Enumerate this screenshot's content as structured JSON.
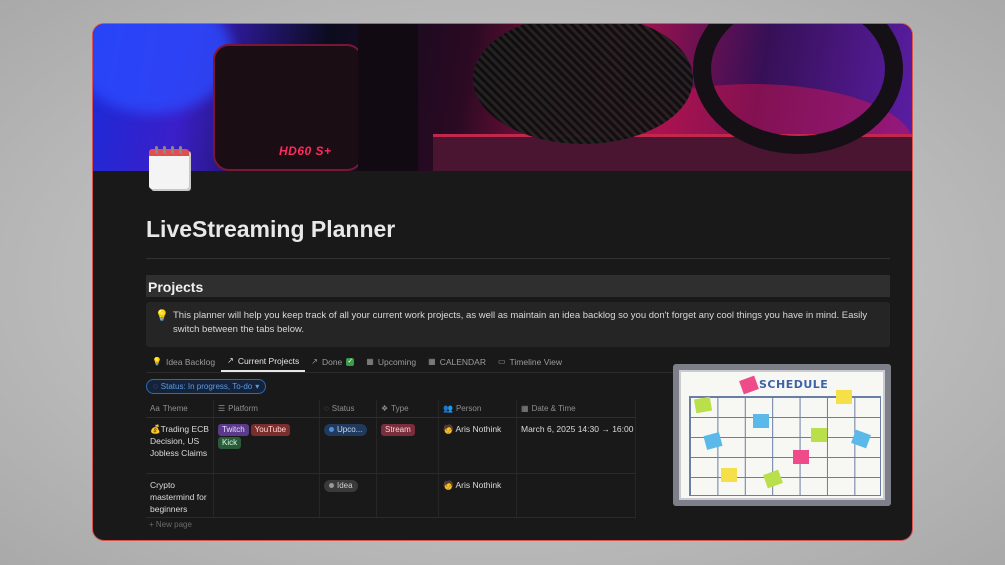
{
  "cover": {
    "brand": "HD60 S+"
  },
  "page": {
    "title": "LiveStreaming Planner",
    "section": "Projects"
  },
  "callout": {
    "text": "This planner will help you keep track of all your current work projects, as well as maintain an idea backlog so you don't forget any cool things you have in mind. Easily switch between the tabs below."
  },
  "tabs": [
    {
      "label": "Idea Backlog",
      "icon": "lightbulb-icon"
    },
    {
      "label": "Current Projects",
      "icon": "arrow-up-right-icon",
      "active": true
    },
    {
      "label": "Done",
      "icon": "arrow-up-right-icon"
    },
    {
      "label": "Upcoming",
      "icon": "calendar-icon"
    },
    {
      "label": "CALENDAR",
      "icon": "calendar-icon"
    },
    {
      "label": "Timeline View",
      "icon": "timeline-icon"
    }
  ],
  "filter": {
    "label": "Status: In progress, To-do"
  },
  "table": {
    "headers": [
      {
        "label": "Theme",
        "icon": "Aa"
      },
      {
        "label": "Platform",
        "icon": "multi-select-icon"
      },
      {
        "label": "Status",
        "icon": "status-icon"
      },
      {
        "label": "Type",
        "icon": "type-icon"
      },
      {
        "label": "Person",
        "icon": "person-icon"
      },
      {
        "label": "Date & Time",
        "icon": "calendar-icon"
      }
    ],
    "rows": [
      {
        "theme": "💰Trading ECB Decision, US Jobless Claims",
        "platforms": [
          "Twitch",
          "YouTube",
          "Kick"
        ],
        "status": "Upco...",
        "type": "Stream",
        "person": "Aris Nothink",
        "date": "March 6, 2025 14:30 → 16:00"
      },
      {
        "theme": "Crypto mastermind for beginners",
        "platforms": [],
        "status": "Idea",
        "type": "",
        "person": "Aris Nothink",
        "date": ""
      }
    ],
    "new_page": "New page"
  },
  "image": {
    "heading": "SCHEDULE"
  },
  "colors": {
    "accent_border": "#d9534f",
    "background": "#191919"
  }
}
